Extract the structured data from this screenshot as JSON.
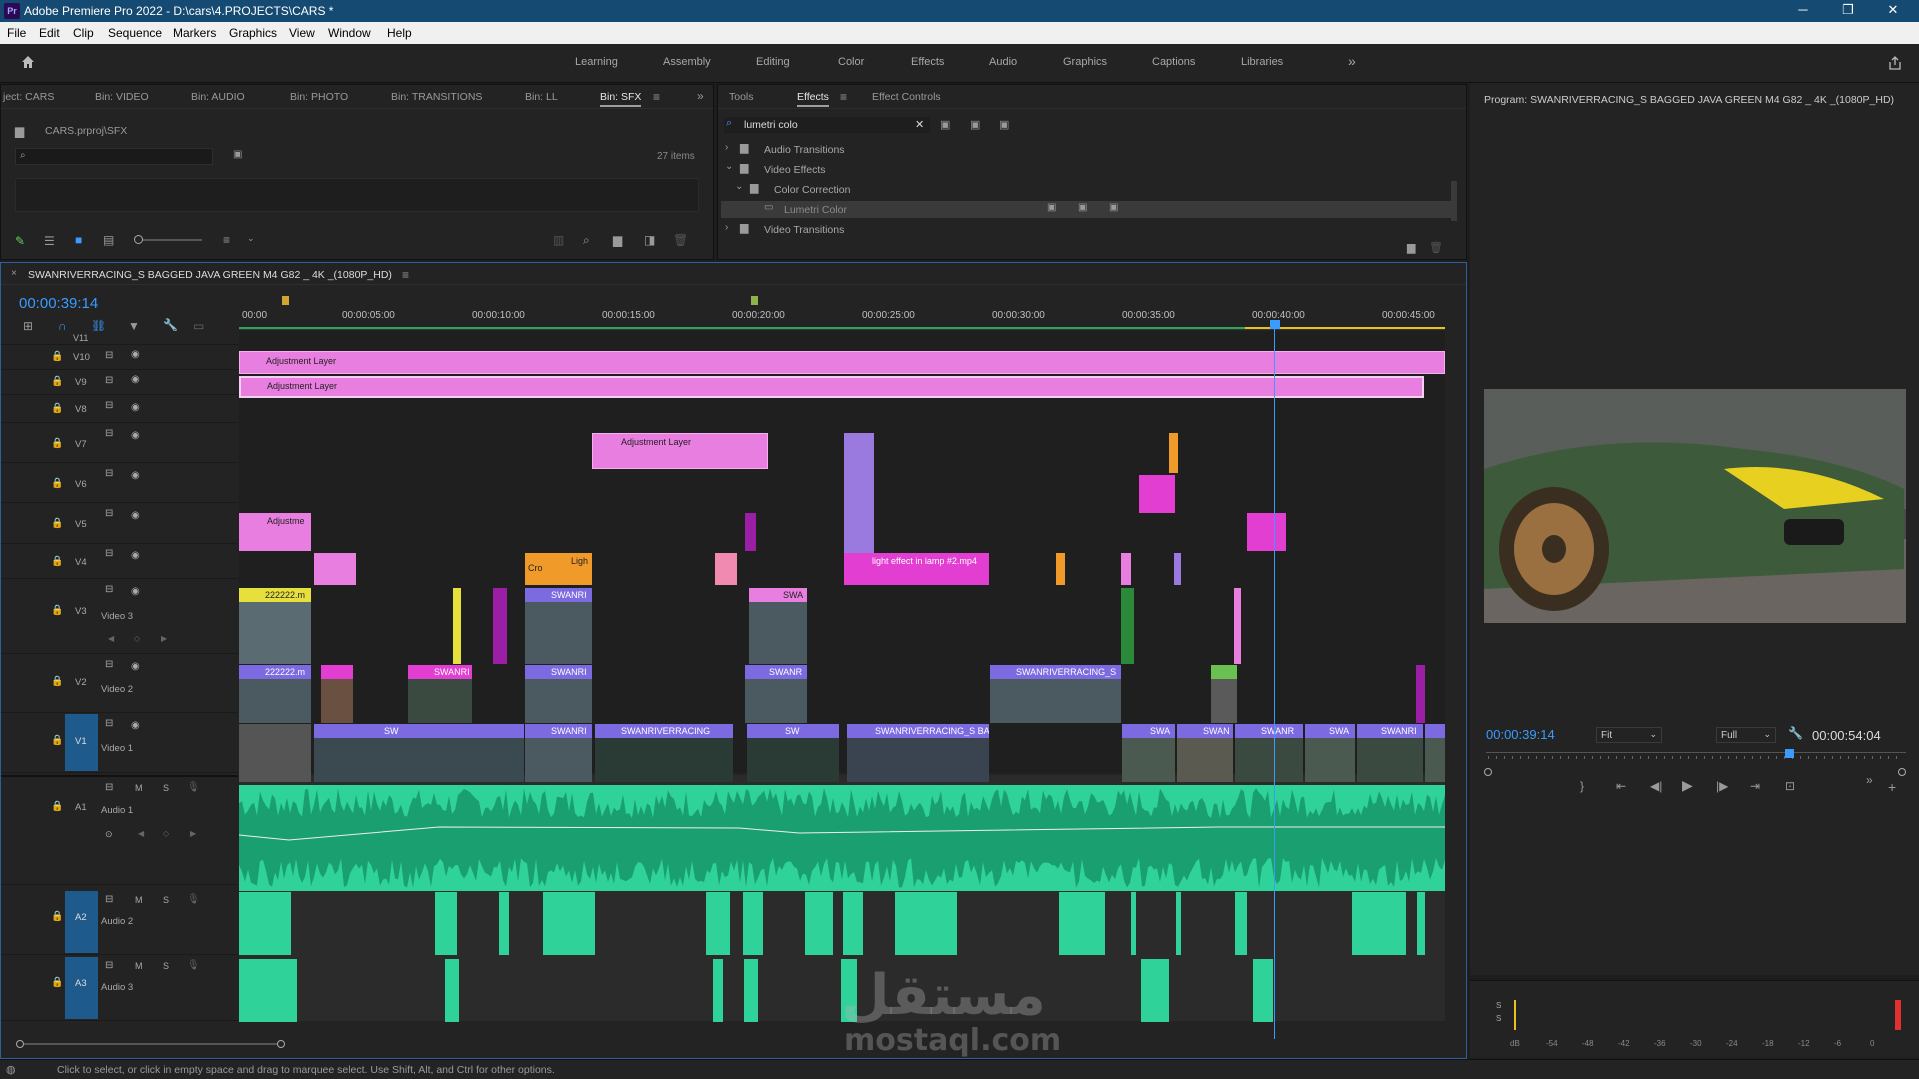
{
  "window": {
    "app_logo": "Pr",
    "title": "Adobe Premiere Pro 2022 - D:\\cars\\4.PROJECTS\\CARS *",
    "minimize": "─",
    "maximize": "❐",
    "close": "✕"
  },
  "menu": [
    "File",
    "Edit",
    "Clip",
    "Sequence",
    "Markers",
    "Graphics",
    "View",
    "Window",
    "Help"
  ],
  "workspaces": [
    "Learning",
    "Assembly",
    "Editing",
    "Color",
    "Effects",
    "Audio",
    "Graphics",
    "Captions",
    "Libraries"
  ],
  "workspace_more": "»",
  "project_panel": {
    "tabs": [
      "ject: CARS",
      "Bin: VIDEO",
      "Bin: AUDIO",
      "Bin: PHOTO",
      "Bin: TRANSITIONS",
      "Bin: LL",
      "Bin: SFX"
    ],
    "active_tab": "Bin: SFX",
    "path": "CARS.prproj\\SFX",
    "item_count": "27 items"
  },
  "effects_panel": {
    "tabs": [
      "Tools",
      "Effects",
      "Effect Controls"
    ],
    "active_tab": "Effects",
    "search_value": "lumetri colo",
    "tree": [
      {
        "label": "Audio Transitions",
        "level": 0,
        "expanded": false
      },
      {
        "label": "Video Effects",
        "level": 0,
        "expanded": true
      },
      {
        "label": "Color Correction",
        "level": 1,
        "expanded": true
      },
      {
        "label": "Lumetri Color",
        "level": 2,
        "selected": true
      },
      {
        "label": "Video Transitions",
        "level": 0,
        "expanded": false
      }
    ]
  },
  "program_monitor": {
    "title": "Program: SWANRIVERRACING_S BAGGED JAVA GREEN M4 G82 _ 4K _(1080P_HD)",
    "timecode": "00:00:39:14",
    "fit": "Fit",
    "quality": "Full",
    "duration": "00:00:54:04",
    "meter_labels": [
      "dB",
      "-54",
      "-48",
      "-42",
      "-36",
      "-30",
      "-24",
      "-18",
      "-12",
      "-6",
      "0"
    ],
    "meter_channels": [
      "S",
      "S"
    ]
  },
  "timeline": {
    "sequence_name": "SWANRIVERRACING_S BAGGED JAVA GREEN M4 G82 _ 4K _(1080P_HD)",
    "timecode": "00:00:39:14",
    "ruler": [
      "00:00",
      "00:00:05:00",
      "00:00:10:00",
      "00:00:15:00",
      "00:00:20:00",
      "00:00:25:00",
      "00:00:30:00",
      "00:00:35:00",
      "00:00:40:00",
      "00:00:45:00"
    ],
    "video_tracks": [
      {
        "id": "V11"
      },
      {
        "id": "V10"
      },
      {
        "id": "V9"
      },
      {
        "id": "V8"
      },
      {
        "id": "V7"
      },
      {
        "id": "V6"
      },
      {
        "id": "V5"
      },
      {
        "id": "V4"
      },
      {
        "id": "V3",
        "name": "Video 3"
      },
      {
        "id": "V2",
        "name": "Video 2"
      },
      {
        "id": "V1",
        "name": "Video 1"
      }
    ],
    "audio_tracks": [
      {
        "id": "A1",
        "name": "Audio 1"
      },
      {
        "id": "A2",
        "name": "Audio 2"
      },
      {
        "id": "A3",
        "name": "Audio 3"
      }
    ],
    "audio_toggles": [
      "M",
      "S"
    ],
    "clip_labels": {
      "adj1": "Adjustment Layer",
      "adj2": "Adjustment Layer",
      "adj3": "Adjustment Layer",
      "adj4": "Adjustme",
      "light": "light effect in lamp #2.mp4",
      "lig": "Ligh",
      "cro": "Cro",
      "v3a": "222222.m",
      "v3b": "SWANRI",
      "v3c": "SWA",
      "v2a": "222222.m",
      "v2b": "SWANRI",
      "v2c": "SWANRI",
      "v2d": "SWANR",
      "v2e": "SWANRIVERRACING_S",
      "v1a": "SW",
      "v1b": "SWANRI",
      "v1c": "SWANRIVERRACING",
      "v1d": "SW",
      "v1e": "SWANRIVERRACING_S BA",
      "v1f": "SWA",
      "v1g": "SWAN",
      "v1h": "SWANR",
      "v1i": "SWA",
      "v1j": "SWANRI"
    }
  },
  "watermark": {
    "arabic": "مستقل",
    "latin": "mostaql.com"
  },
  "status": "Click to select, or click in empty space and drag to marquee select. Use Shift, Alt, and Ctrl for other options.",
  "colors": {
    "accent": "#3b9bff",
    "adjustment": "#e87fe0",
    "clip_violet": "#7c6ae0",
    "audio": "#2fd39a",
    "title_bar": "#154a72"
  }
}
